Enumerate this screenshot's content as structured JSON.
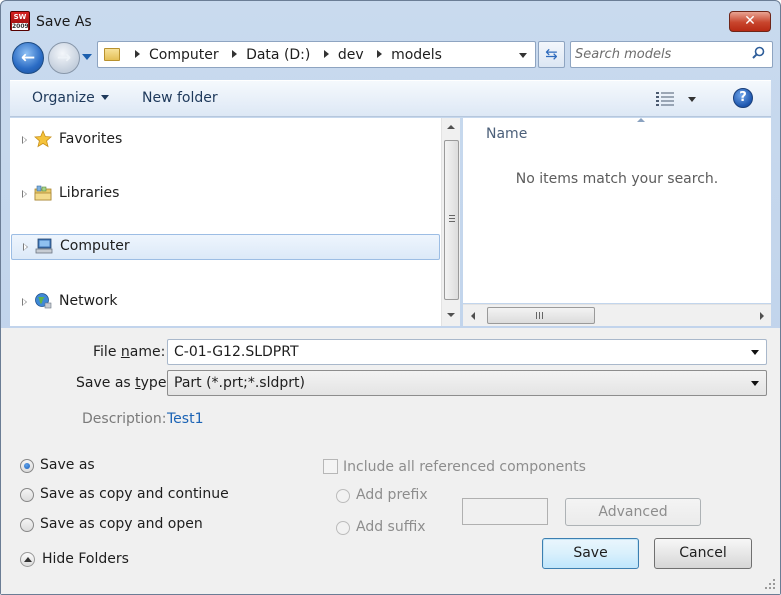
{
  "window": {
    "title": "Save As",
    "app_icon_lines": [
      "SW",
      "2009"
    ],
    "close_glyph": "✕"
  },
  "nav": {
    "back_glyph": "←",
    "forward_glyph": "→",
    "breadcrumbs": [
      "Computer",
      "Data (D:)",
      "dev",
      "models"
    ],
    "refresh_glyph": "⇆",
    "search_placeholder": "Search models"
  },
  "toolbar": {
    "organize_label": "Organize",
    "new_folder_label": "New folder",
    "help_glyph": "?"
  },
  "tree": {
    "items": [
      {
        "label": "Favorites",
        "icon": "star-icon"
      },
      {
        "label": "Libraries",
        "icon": "libraries-icon"
      },
      {
        "label": "Computer",
        "icon": "computer-icon",
        "selected": true
      },
      {
        "label": "Network",
        "icon": "network-icon"
      }
    ]
  },
  "files": {
    "column_header": "Name",
    "empty_message": "No items match your search."
  },
  "form": {
    "file_name_label_pre": "File ",
    "file_name_label_ul": "n",
    "file_name_label_post": "ame:",
    "file_name_value": "C-01-G12.SLDPRT",
    "save_type_label_pre": "Save as ",
    "save_type_label_ul": "t",
    "save_type_label_post": "ype:",
    "save_type_value": "Part (*.prt;*.sldprt)",
    "description_label": "Description:",
    "description_value": "Test1"
  },
  "options": {
    "save_as": "Save as",
    "save_copy_continue": "Save as copy and continue",
    "save_copy_open": "Save as copy and open",
    "selected": "save_as",
    "include_refs": "Include all referenced components",
    "add_prefix": "Add prefix",
    "add_suffix": "Add suffix",
    "advanced": "Advanced"
  },
  "footer": {
    "hide_folders": "Hide Folders",
    "save": "Save",
    "cancel": "Cancel"
  },
  "colors": {
    "accent": "#1c5fae",
    "link": "#1b63b5",
    "disabled_text": "#8d8d8d"
  }
}
